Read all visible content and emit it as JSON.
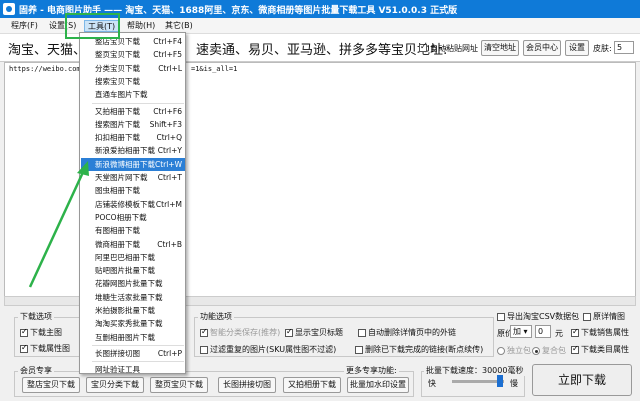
{
  "window": {
    "title": "固养 - 电商图片助手 —— 淘宝、天猫、1688阿里、京东、微商相册等图片批量下载工具 V51.0.0.3 正式版"
  },
  "menubar": {
    "items": [
      "程序(F)",
      "设置(S)",
      "工具(T)",
      "帮助(H)",
      "其它(B)"
    ]
  },
  "toprow": {
    "label_left": "淘宝、天猫、",
    "label_right": "速卖通、易贝、亚马逊、拼多多等宝贝地址:",
    "auto_paste": "自动粘贴网址",
    "clear_button": "清空地址",
    "member_button": "会员中心",
    "settings_button": "设置",
    "skin_label": "皮肤:",
    "skin_value": "5"
  },
  "textarea": {
    "url_left": "https://weibo.com/d",
    "url_right": "=1&is_all=1"
  },
  "dropdown": {
    "items": [
      {
        "label": "整店宝贝下载",
        "shortcut": "Ctrl+F4"
      },
      {
        "label": "整页宝贝下载",
        "shortcut": "Ctrl+F5"
      },
      {
        "label": "分类宝贝下载",
        "shortcut": "Ctrl+L"
      },
      {
        "label": "搜索宝贝下载",
        "shortcut": ""
      },
      {
        "label": "直通车图片下载",
        "shortcut": ""
      },
      {
        "label": "又拍相册下载",
        "shortcut": "Ctrl+F6",
        "sep_before": true
      },
      {
        "label": "搜索图片下载",
        "shortcut": "Shift+F3"
      },
      {
        "label": "扣扣相册下载",
        "shortcut": "Ctrl+Q"
      },
      {
        "label": "新浪爱拍相册下载",
        "shortcut": "Ctrl+Y"
      },
      {
        "label": "新浪微博相册下载",
        "shortcut": "Ctrl+W",
        "highlight": true
      },
      {
        "label": "天堂图片网下载",
        "shortcut": "Ctrl+T"
      },
      {
        "label": "图虫相册下载",
        "shortcut": ""
      },
      {
        "label": "店铺装修模板下载",
        "shortcut": "Ctrl+M"
      },
      {
        "label": "POCO相册下载",
        "shortcut": ""
      },
      {
        "label": "有图相册下载",
        "shortcut": ""
      },
      {
        "label": "微商相册下载",
        "shortcut": "Ctrl+B"
      },
      {
        "label": "阿里巴巴相册下载",
        "shortcut": ""
      },
      {
        "label": "贴吧图片批量下载",
        "shortcut": ""
      },
      {
        "label": "花瓣网图片批量下载",
        "shortcut": ""
      },
      {
        "label": "堆糖生活家批量下载",
        "shortcut": ""
      },
      {
        "label": "米拍摄影批量下载",
        "shortcut": ""
      },
      {
        "label": "淘淘买家秀批量下载",
        "shortcut": ""
      },
      {
        "label": "互删相册图片下载",
        "shortcut": ""
      },
      {
        "label": "长图拼接切图",
        "shortcut": "Ctrl+P",
        "sep_before": true
      },
      {
        "label": "网址验证工具",
        "shortcut": "",
        "sep_before": true
      }
    ]
  },
  "download_options": {
    "title": "下载选项",
    "main_image": "下载主图",
    "attr_image": "下载属性图"
  },
  "function_options": {
    "title": "功能选项",
    "smart_category": "智能分类保存(推荐)",
    "show_title": "显示宝贝标题",
    "auto_delete_outer": "自动删除详情页中的外链",
    "filter_duplicate": "过滤重复的图片(SKU属性图不过滤)",
    "delete_completed": "删除已下载完成的链接(断点续传)"
  },
  "right_options": {
    "export_csv": "导出淘宝CSV数据包",
    "original_detail": "原详情图",
    "price_label": "原价",
    "price_op": "加",
    "price_value": "0",
    "price_unit": "元",
    "sales_attr": "下载销售属性",
    "standalone": "独立包",
    "composite": "复合包",
    "category_attr": "下载类目属性"
  },
  "member_services": {
    "title": "会员专享",
    "more_link": "更多专享功能:",
    "buttons": [
      "整店宝贝下载",
      "宝贝分类下载",
      "整页宝贝下载",
      "长图拼接切图",
      "又拍相册下载",
      "批量加水印设置"
    ]
  },
  "speed": {
    "label": "批量下载速度：30000毫秒",
    "slow": "快",
    "fast": "慢",
    "value": 0.95
  },
  "start_button": "立即下载",
  "colors": {
    "titlebar": "#0f7ad8",
    "highlight": "#2b7fd6",
    "annotation": "#2db24a"
  }
}
